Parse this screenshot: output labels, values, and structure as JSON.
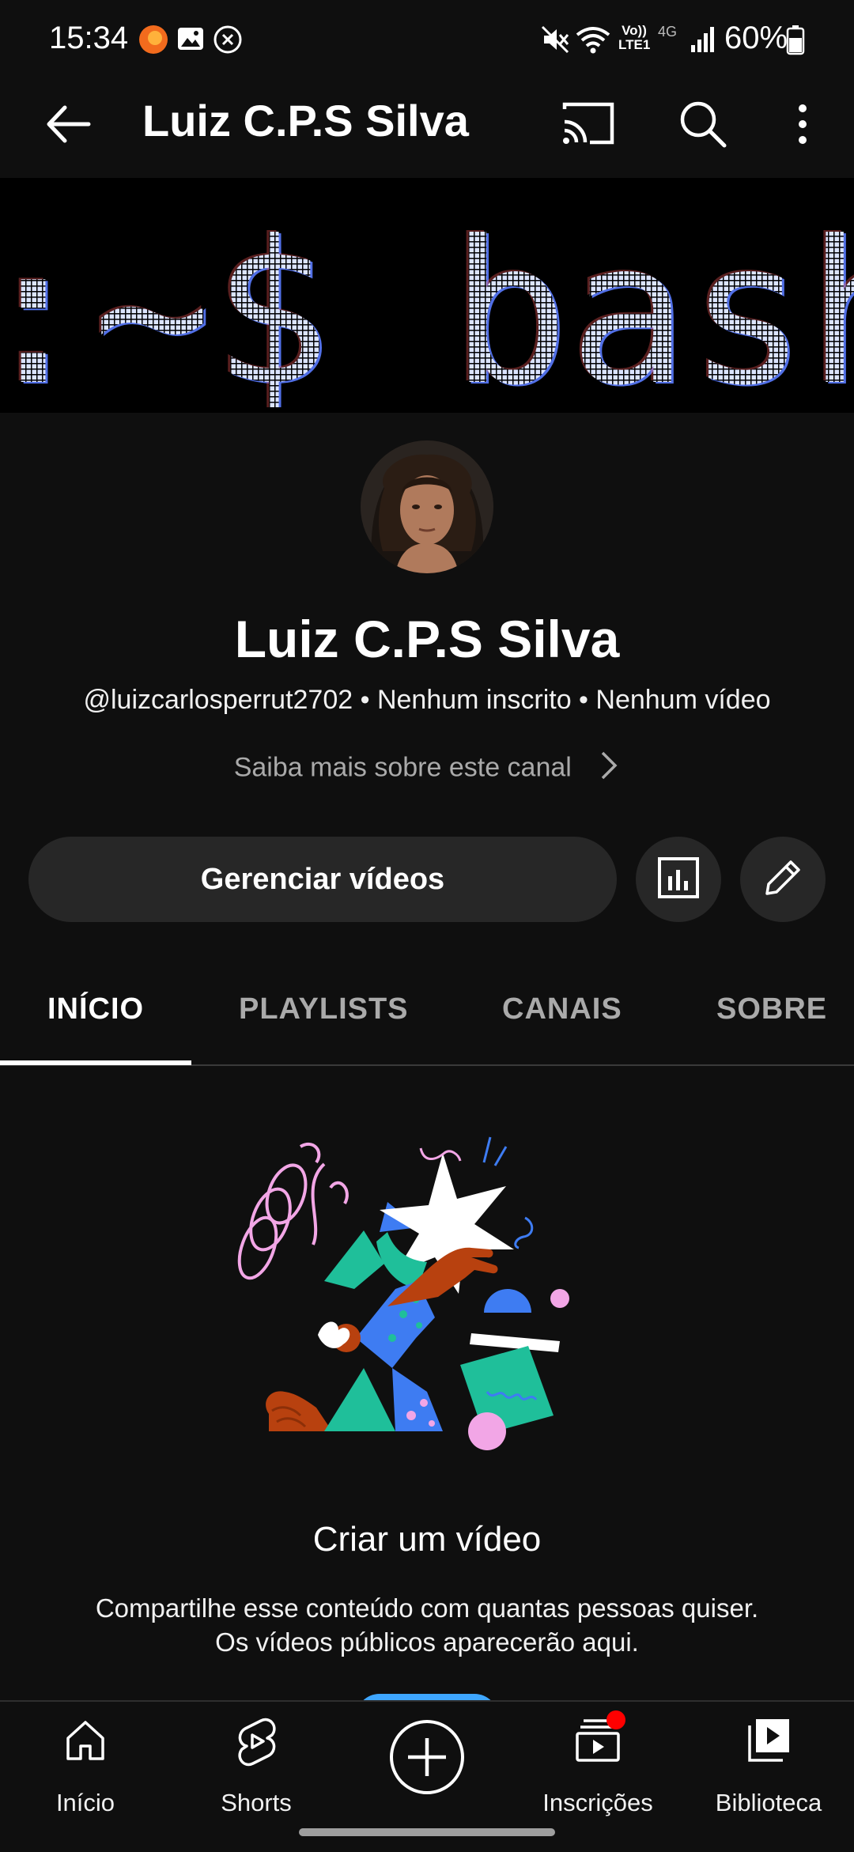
{
  "status_bar": {
    "time": "15:34",
    "battery": "60%",
    "network_label": "4G",
    "volte_label": "Vo)) LTE1"
  },
  "app_bar": {
    "title": "Luiz C.P.S Silva",
    "icons": [
      "back-arrow-icon",
      "cast-icon",
      "search-icon",
      "more-vert-icon"
    ]
  },
  "banner": {
    "text": ":~$ bash_"
  },
  "channel": {
    "name": "Luiz C.P.S Silva",
    "meta": "@luizcarlosperrut2702 • Nenhum inscrito • Nenhum vídeo",
    "more_about": "Saiba mais sobre este canal"
  },
  "actions": {
    "manage_videos": "Gerenciar vídeos",
    "icons": [
      "analytics-icon",
      "edit-pencil-icon"
    ]
  },
  "tabs": [
    {
      "label": "INÍCIO",
      "selected": true
    },
    {
      "label": "PLAYLISTS",
      "selected": false
    },
    {
      "label": "CANAIS",
      "selected": false
    },
    {
      "label": "SOBRE",
      "selected": false
    }
  ],
  "empty_state": {
    "title": "Criar um vídeo",
    "description_line1": "Compartilhe esse conteúdo com quantas pessoas quiser.",
    "description_line2": "Os vídeos públicos aparecerão aqui."
  },
  "bottom_nav": {
    "home": "Início",
    "shorts": "Shorts",
    "subscriptions": "Inscrições",
    "library": "Biblioteca"
  },
  "colors": {
    "background": "#0f0f0f",
    "surface": "#272727",
    "accent_blue": "#3ea6ff",
    "notification_red": "#ff0000"
  }
}
